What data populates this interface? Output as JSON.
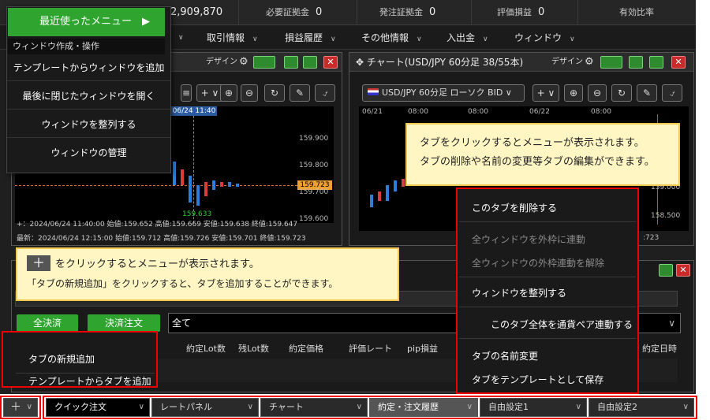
{
  "topbar": {
    "balance": "2,909,870",
    "margin_label": "必要証拠金",
    "margin_val": "0",
    "order_margin_label": "発注証拠金",
    "order_margin_val": "0",
    "pl_label": "評価損益",
    "pl_val": "0",
    "ratio_label": "有効比率"
  },
  "menubar": [
    "取引情報",
    "損益履歴",
    "その他情報",
    "入出金",
    "ウィンドウ"
  ],
  "menu_left": {
    "head": "最近使ったメニュー",
    "arrow": "▶",
    "section": "ウィンドウ作成・操作",
    "items": [
      "テンプレートからウィンドウを追加",
      "最後に閉じたウィンドウを開く",
      "ウィンドウを整列する",
      "ウィンドウの管理"
    ]
  },
  "chart_left": {
    "design": "デザイン",
    "cross_label": "06/24 11:40",
    "prices": [
      "159.900",
      "159.800",
      "159.723",
      "159.700",
      "159.600"
    ],
    "low_label": "159.633",
    "info1": "+：2024/06/24 11:40:00 始値:159.652 高値:159.669 安値:159.638 終値:159.647",
    "info2": "最新：2024/06/24 12:15:00 始値:159.712 高値:159.726 安値:159.701 終値:159.723"
  },
  "chart_right": {
    "title": "チャート(USD/JPY 60分足 38/55本)",
    "design": "デザイン",
    "symbol": "USD/JPY 60分足 ローソク BID",
    "times": [
      "06/21",
      "08:00",
      "08:00",
      "06/22",
      "08:00"
    ],
    "prices": [
      "159.000",
      "158.500"
    ],
    "info": ":723"
  },
  "callout_top": {
    "line1": "タブをクリックするとメニューが表示されます。",
    "line2": "タブの削除や名前の変更等タブの編集ができます。"
  },
  "callout_left": {
    "line1": "をクリックするとメニューが表示されます。",
    "line2": "「タブの新規追加」をクリックすると、タブを追加することができます。"
  },
  "menu_right": {
    "items": [
      "このタブを削除する",
      "全ウィンドウを外枠に連動",
      "全ウィンドウの外枠連動を解除",
      "ウィンドウを整列する",
      "このタブ全体を通貨ペア連動する",
      "タブの名前変更",
      "タブをテンプレートとして保存"
    ]
  },
  "menu_bottom_left": {
    "items": [
      "タブの新規追加",
      "テンプレートからタブを追加"
    ]
  },
  "position_panel": {
    "close_all": "全決済",
    "close_order": "決済注文",
    "filter": "全て",
    "headers": [
      "約定Lot数",
      "残Lot数",
      "約定価格",
      "評価レート",
      "pip損益"
    ],
    "extra_header": "約定日時"
  },
  "tabs": {
    "add": "＋",
    "items": [
      "クイック注文",
      "レートパネル",
      "チャート",
      "約定・注文履歴",
      "自由設定1",
      "自由設定2"
    ]
  }
}
